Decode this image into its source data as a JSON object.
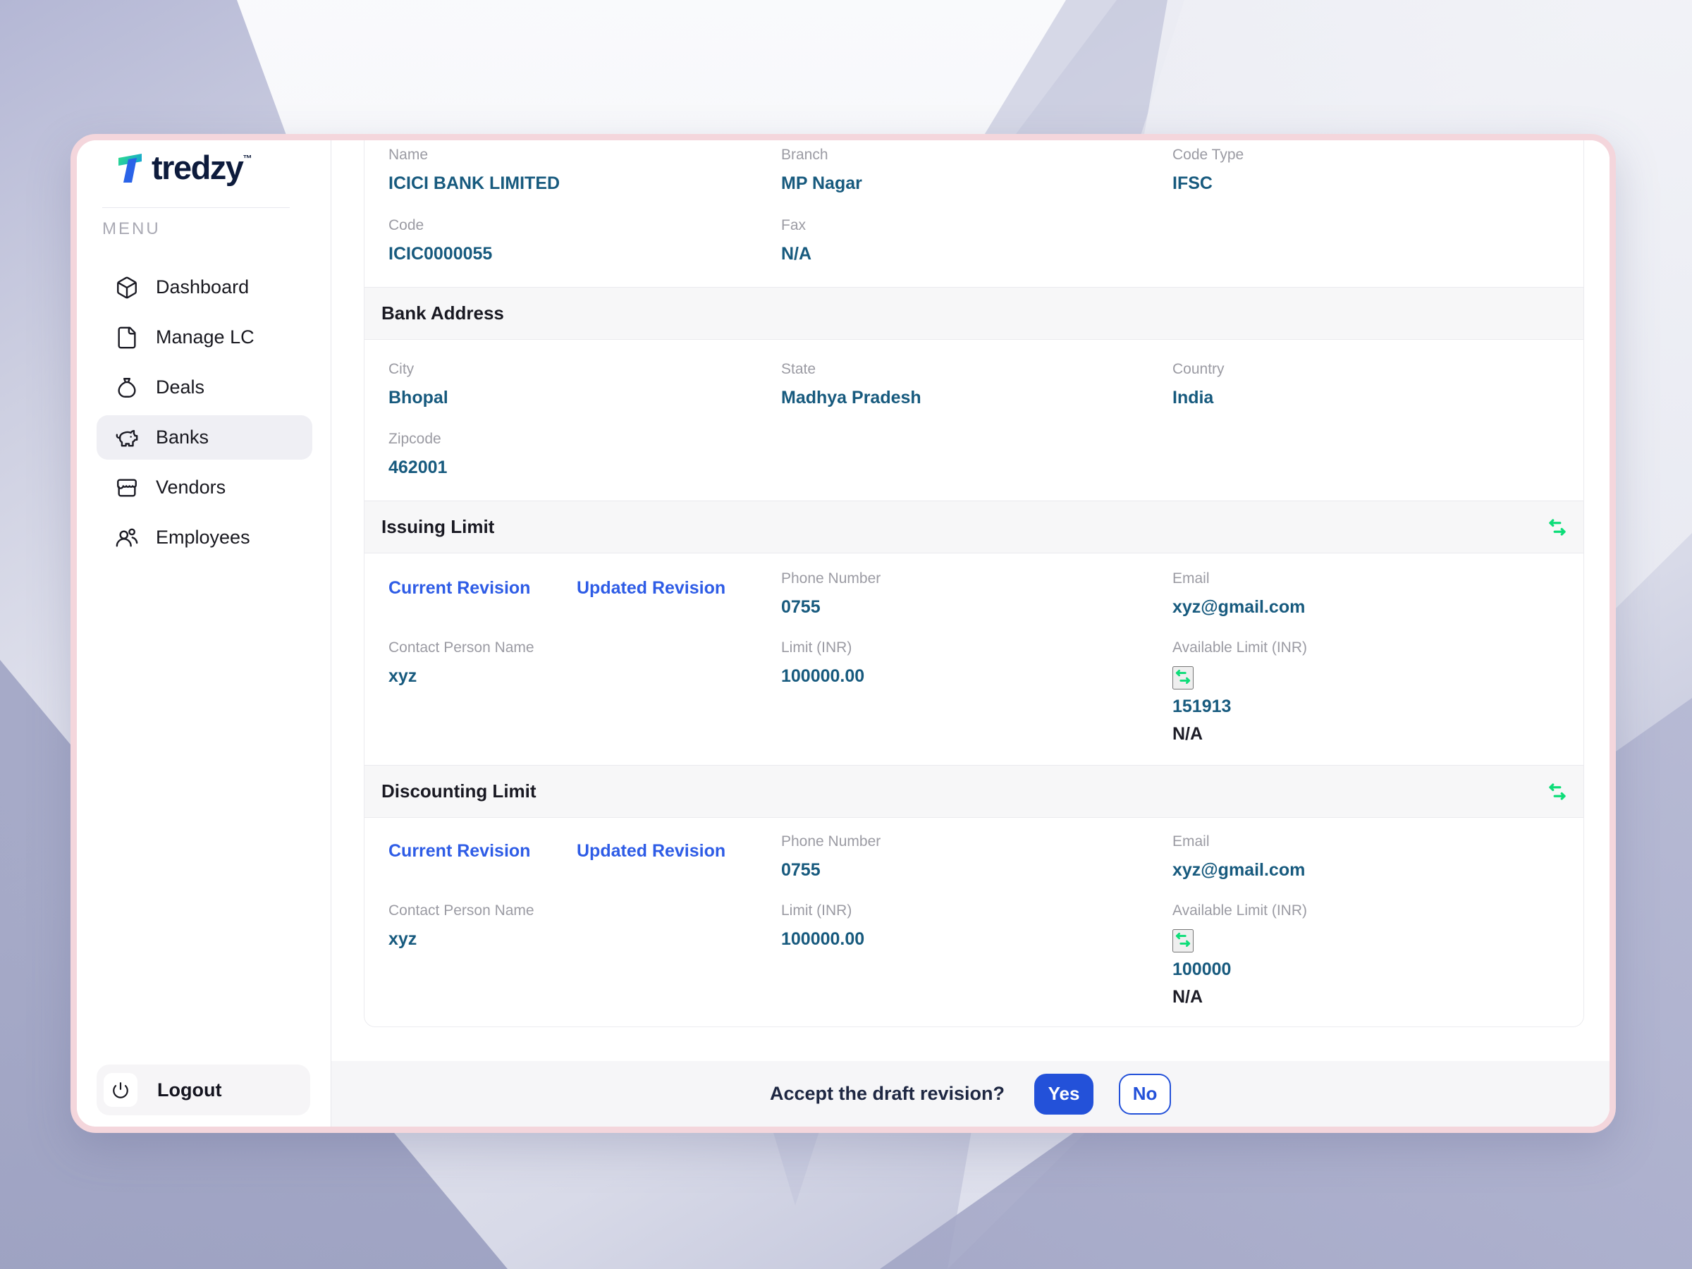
{
  "app": {
    "logo_text": "tredzy",
    "logo_tm": "TM"
  },
  "sidebar": {
    "menu_label": "MENU",
    "items": [
      {
        "label": "Dashboard",
        "icon": "package-icon",
        "active": false
      },
      {
        "label": "Manage LC",
        "icon": "file-icon",
        "active": false
      },
      {
        "label": "Deals",
        "icon": "money-bag-icon",
        "active": false
      },
      {
        "label": "Banks",
        "icon": "piggy-bank-icon",
        "active": true
      },
      {
        "label": "Vendors",
        "icon": "storefront-icon",
        "active": false
      },
      {
        "label": "Employees",
        "icon": "users-icon",
        "active": false
      }
    ],
    "logout_label": "Logout"
  },
  "bank_info": {
    "fields": [
      {
        "label": "Name",
        "value": "ICICI BANK LIMITED"
      },
      {
        "label": "Branch",
        "value": "MP Nagar"
      },
      {
        "label": "Code Type",
        "value": "IFSC"
      },
      {
        "label": "Code",
        "value": "ICIC0000055"
      },
      {
        "label": "Fax",
        "value": "N/A"
      }
    ]
  },
  "bank_address": {
    "title": "Bank Address",
    "fields": [
      {
        "label": "City",
        "value": "Bhopal"
      },
      {
        "label": "State",
        "value": "Madhya Pradesh"
      },
      {
        "label": "Country",
        "value": "India"
      },
      {
        "label": "Zipcode",
        "value": "462001"
      }
    ]
  },
  "issuing_limit": {
    "title": "Issuing Limit",
    "tabs": [
      {
        "label": "Current Revision"
      },
      {
        "label": "Updated Revision"
      }
    ],
    "phone": {
      "label": "Phone Number",
      "value": "0755"
    },
    "email": {
      "label": "Email",
      "value": "xyz@gmail.com"
    },
    "contact": {
      "label": "Contact Person Name",
      "value": "xyz"
    },
    "limit": {
      "label": "Limit (INR)",
      "value": "100000.00"
    },
    "available": {
      "label": "Available Limit (INR)",
      "value": "151913",
      "secondary": "N/A"
    }
  },
  "discounting_limit": {
    "title": "Discounting Limit",
    "tabs": [
      {
        "label": "Current Revision"
      },
      {
        "label": "Updated Revision"
      }
    ],
    "phone": {
      "label": "Phone Number",
      "value": "0755"
    },
    "email": {
      "label": "Email",
      "value": "xyz@gmail.com"
    },
    "contact": {
      "label": "Contact Person Name",
      "value": "xyz"
    },
    "limit": {
      "label": "Limit (INR)",
      "value": "100000.00"
    },
    "available": {
      "label": "Available Limit (INR)",
      "value": "100000",
      "secondary": "N/A"
    }
  },
  "footer": {
    "question": "Accept the draft revision?",
    "yes_label": "Yes",
    "no_label": "No"
  },
  "colors": {
    "accent_link_blue": "#2e5ce6",
    "button_blue": "#2351d9",
    "value_teal": "#175a7e",
    "swap_green": "#0ddd78",
    "card_border_pink": "#f4d6dc",
    "section_band_bg": "#f7f7f8"
  }
}
